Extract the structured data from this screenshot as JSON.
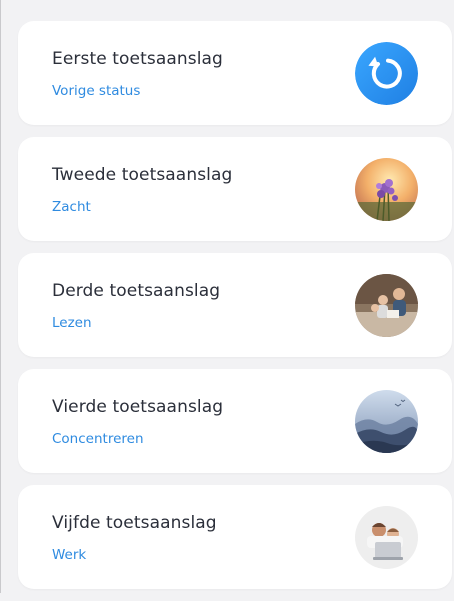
{
  "items": [
    {
      "title": "Eerste toetsaanslag",
      "subtitle": "Vorige status",
      "icon": "restore-icon"
    },
    {
      "title": "Tweede toetsaanslag",
      "subtitle": "Zacht",
      "icon": "flowers-image"
    },
    {
      "title": "Derde toetsaanslag",
      "subtitle": "Lezen",
      "icon": "family-reading-image"
    },
    {
      "title": "Vierde toetsaanslag",
      "subtitle": "Concentreren",
      "icon": "misty-forest-image"
    },
    {
      "title": "Vijfde toetsaanslag",
      "subtitle": "Werk",
      "icon": "laptop-work-image"
    }
  ],
  "colors": {
    "background": "#f2f2f4",
    "card": "#ffffff",
    "title": "#2b2f3a",
    "accent": "#2f8be0"
  }
}
